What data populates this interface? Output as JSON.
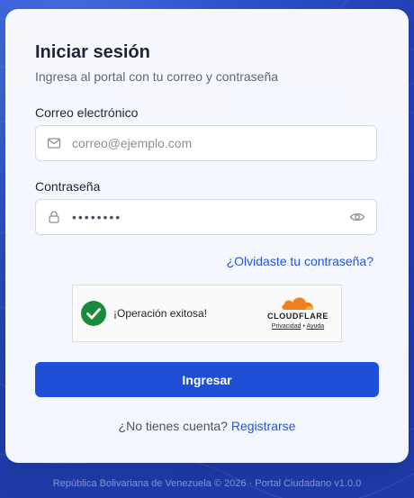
{
  "login": {
    "title": "Iniciar sesión",
    "subtitle": "Ingresa al portal con tu correo y contraseña",
    "email_label": "Correo electrónico",
    "email_placeholder": "correo@ejemplo.com",
    "email_value": "",
    "password_label": "Contraseña",
    "password_value": "xxxxxxxx",
    "forgot_link": "¿Olvidaste tu contraseña?",
    "submit_label": "Ingresar",
    "no_account_text": "¿No tienes cuenta?",
    "register_link": "Registrarse"
  },
  "captcha": {
    "status_text": "¡Operación exitosa!",
    "brand": "CLOUDFLARE",
    "privacy_link": "Privacidad",
    "separator": "•",
    "help_link": "Ayuda"
  },
  "footer": {
    "text": "República Bolivariana de Venezuela © 2026 · Portal Ciudadano v1.0.0"
  },
  "colors": {
    "primary": "#1f4fd6",
    "link": "#2356d8",
    "success": "#1a8a3f",
    "cloudflare_orange": "#f38020"
  },
  "icons": {
    "email": "mail-icon",
    "password": "lock-icon",
    "toggle": "eye-icon",
    "captcha_check": "check-circle-icon",
    "captcha_brand": "cloud-icon"
  }
}
